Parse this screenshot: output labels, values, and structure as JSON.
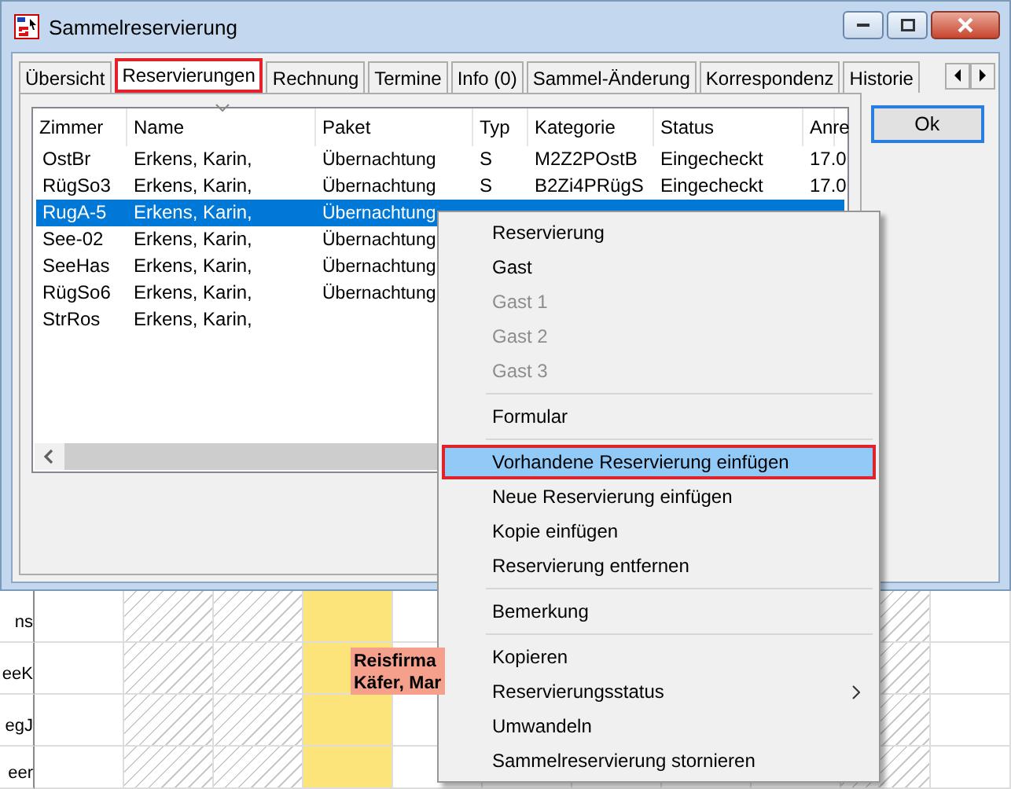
{
  "window": {
    "title": "Sammelreservierung"
  },
  "tabs": [
    {
      "label": "Übersicht",
      "selected": false
    },
    {
      "label": "Reservierungen",
      "selected": true
    },
    {
      "label": "Rechnung",
      "selected": false
    },
    {
      "label": "Termine",
      "selected": false
    },
    {
      "label": "Info (0)",
      "selected": false
    },
    {
      "label": "Sammel-Änderung",
      "selected": false
    },
    {
      "label": "Korrespondenz",
      "selected": false
    },
    {
      "label": "Historie",
      "selected": false
    }
  ],
  "list": {
    "columns": [
      "Zimmer",
      "Name",
      "Paket",
      "Typ",
      "Kategorie",
      "Status",
      "Anre"
    ],
    "rows": [
      {
        "cells": [
          "OstBr",
          "Erkens, Karin,",
          "Übernachtung",
          "S",
          "M2Z2POstB",
          "Eingecheckt",
          "17.0"
        ],
        "selected": false
      },
      {
        "cells": [
          "RügSo3",
          "Erkens, Karin,",
          "Übernachtung",
          "S",
          "B2Zi4PRügS",
          "Eingecheckt",
          "17.0"
        ],
        "selected": false
      },
      {
        "cells": [
          "RugA-5",
          "Erkens, Karin,",
          "Übernachtung"
        ],
        "selected": true
      },
      {
        "cells": [
          "See-02",
          "Erkens, Karin,",
          "Übernachtung"
        ],
        "selected": false
      },
      {
        "cells": [
          "SeeHas",
          "Erkens, Karin,",
          "Übernachtung"
        ],
        "selected": false
      },
      {
        "cells": [
          "RügSo6",
          "Erkens, Karin,",
          "Übernachtung"
        ],
        "selected": false
      },
      {
        "cells": [
          "StrRos",
          "Erkens, Karin,"
        ],
        "selected": false
      }
    ]
  },
  "ok_button": "Ok",
  "context_menu": [
    {
      "kind": "item",
      "label": "Reservierung",
      "disabled": false,
      "selected": false,
      "submenu": false
    },
    {
      "kind": "item",
      "label": "Gast",
      "disabled": false,
      "selected": false,
      "submenu": false
    },
    {
      "kind": "item",
      "label": "Gast 1",
      "disabled": true,
      "selected": false,
      "submenu": false
    },
    {
      "kind": "item",
      "label": "Gast 2",
      "disabled": true,
      "selected": false,
      "submenu": false
    },
    {
      "kind": "item",
      "label": "Gast 3",
      "disabled": true,
      "selected": false,
      "submenu": false
    },
    {
      "kind": "separator"
    },
    {
      "kind": "item",
      "label": "Formular",
      "disabled": false,
      "selected": false,
      "submenu": false
    },
    {
      "kind": "separator"
    },
    {
      "kind": "item",
      "label": "Vorhandene Reservierung einfügen",
      "disabled": false,
      "selected": true,
      "submenu": false
    },
    {
      "kind": "item",
      "label": "Neue Reservierung einfügen",
      "disabled": false,
      "selected": false,
      "submenu": false
    },
    {
      "kind": "item",
      "label": "Kopie einfügen",
      "disabled": false,
      "selected": false,
      "submenu": false
    },
    {
      "kind": "item",
      "label": "Reservierung entfernen",
      "disabled": false,
      "selected": false,
      "submenu": false
    },
    {
      "kind": "separator"
    },
    {
      "kind": "item",
      "label": "Bemerkung",
      "disabled": false,
      "selected": false,
      "submenu": false
    },
    {
      "kind": "separator"
    },
    {
      "kind": "item",
      "label": "Kopieren",
      "disabled": false,
      "selected": false,
      "submenu": false
    },
    {
      "kind": "item",
      "label": "Reservierungsstatus",
      "disabled": false,
      "selected": false,
      "submenu": true
    },
    {
      "kind": "item",
      "label": "Umwandeln",
      "disabled": false,
      "selected": false,
      "submenu": false
    },
    {
      "kind": "item",
      "label": "Sammelreservierung stornieren",
      "disabled": false,
      "selected": false,
      "submenu": false
    }
  ],
  "calendar": {
    "row_labels": [
      "ns",
      "eeK",
      "egJ",
      "eer"
    ],
    "columns": [
      {
        "kind": "plain"
      },
      {
        "kind": "hatched"
      },
      {
        "kind": "hatched"
      },
      {
        "kind": "today"
      },
      {
        "kind": "plain"
      },
      {
        "kind": "plain"
      },
      {
        "kind": "plain"
      },
      {
        "kind": "plain"
      },
      {
        "kind": "plain"
      },
      {
        "kind": "hatched"
      },
      {
        "kind": "plain"
      }
    ],
    "booking": {
      "lines": [
        "Reisfirma",
        "Käfer, Mar"
      ]
    }
  }
}
